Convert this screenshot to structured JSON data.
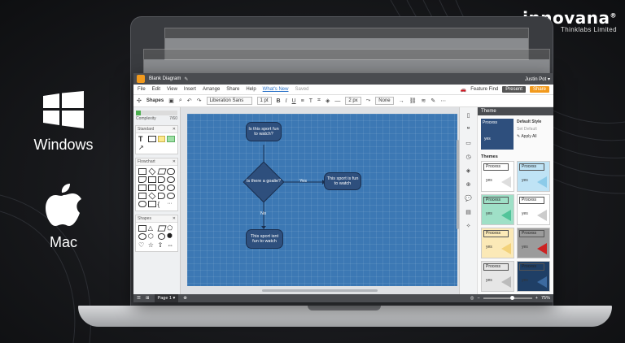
{
  "brand": {
    "name": "innovana",
    "registered": "®",
    "tagline": "Thinklabs Limited"
  },
  "platforms": [
    {
      "label": "Windows",
      "icon": "windows-logo-icon"
    },
    {
      "label": "Mac",
      "icon": "apple-logo-icon"
    }
  ],
  "app": {
    "title": "Blank Diagram",
    "user": "Justin Pot ▾",
    "menu": [
      "File",
      "Edit",
      "View",
      "Insert",
      "Arrange",
      "Share",
      "Help"
    ],
    "whats_new": "What's New",
    "saved": "Saved",
    "feature_find": "Feature Find",
    "present": "Present",
    "share": "Share",
    "toolbar": {
      "shapes": "Shapes",
      "font": "Liberation Sans",
      "font_size": "1 pt",
      "line_width": "2 px",
      "line_end": "None"
    },
    "left_panel": {
      "complexity_label": "Complexity",
      "complexity_value": "7/60",
      "complexity_fraction": 0.12,
      "sections": [
        "Standard",
        "Flowchart",
        "Shapes"
      ]
    },
    "diagram": {
      "node1": "Is this sport fun to watch?",
      "decision": "Is there a goalie?",
      "yes_node": "This sport is fun to watch",
      "no_node": "This sport isnt fun to watch",
      "yes_label": "Yes",
      "no_label": "No"
    },
    "theme_panel": {
      "header": "Theme",
      "current_box": "Process",
      "current_yes": "yes",
      "default_style": "Default Style",
      "set_default": "Set Default",
      "apply_all": "Apply All",
      "themes_title": "Themes",
      "cards": [
        {
          "label": "Process",
          "yes": "yes",
          "accent": "#ffffff",
          "tri": "#dddddd"
        },
        {
          "label": "Process",
          "yes": "yes",
          "accent": "#bfe3f5",
          "tri": "#8ccbe9"
        },
        {
          "label": "Process",
          "yes": "yes",
          "accent": "#9fe0c7",
          "tri": "#52c49a"
        },
        {
          "label": "Process",
          "yes": "yes",
          "accent": "#ffffff",
          "tri": "#cccccc"
        },
        {
          "label": "Process",
          "yes": "yes",
          "accent": "#fbe9b7",
          "tri": "#f3d27a"
        },
        {
          "label": "Process",
          "yes": "yes",
          "accent": "#9b9b9b",
          "tri": "#cc2222"
        },
        {
          "label": "Process",
          "yes": "yes",
          "accent": "#e6e6e6",
          "tri": "#bbbbbb"
        },
        {
          "label": "Process",
          "yes": "yes",
          "accent": "#1f3f66",
          "tri": "#3c6aa0"
        }
      ]
    },
    "bottom": {
      "page": "Page 1 ▾",
      "zoom": "75%",
      "zoom_fraction": 0.55
    }
  },
  "colors": {
    "accent": "#f29a1d",
    "canvas": "#3c78b4",
    "node": "#2e4f7d"
  }
}
